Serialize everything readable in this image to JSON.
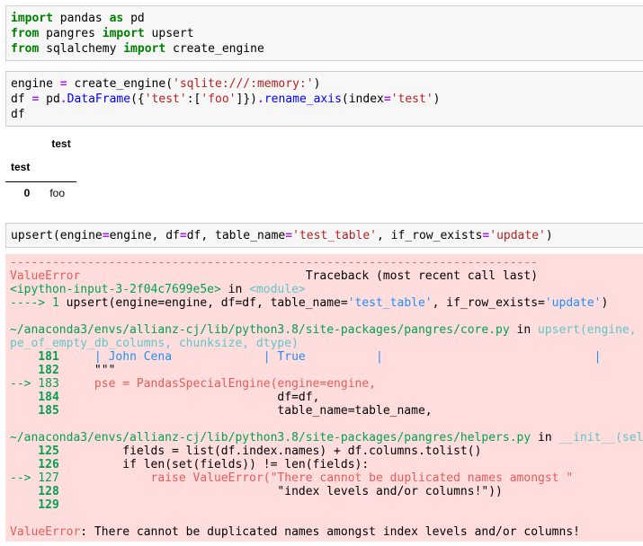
{
  "cell1": {
    "l1": [
      "import",
      " pandas ",
      "as",
      " pd"
    ],
    "l2": [
      "from",
      " pangres ",
      "import",
      " upsert"
    ],
    "l3": [
      "from",
      " sqlalchemy ",
      "import",
      " create_engine"
    ]
  },
  "cell2": {
    "l1a": "engine ",
    "l1b": "=",
    "l1c": " create_engine(",
    "l1d": "'sqlite:///:memory:'",
    "l1e": ")",
    "l2a": "df ",
    "l2b": "=",
    "l2c": " pd",
    "l2d": ".",
    "l2e": "DataFrame",
    "l2f": "({",
    "l2g": "'test'",
    "l2h": ":[",
    "l2i": "'foo'",
    "l2j": "]})",
    "l2k": ".",
    "l2l": "rename_axis",
    "l2m": "(index",
    "l2n": "=",
    "l2o": "'test'",
    "l2p": ")",
    "l3": "df"
  },
  "dataframe": {
    "col_header": "test",
    "index_name": "test",
    "rows": [
      {
        "index": "0",
        "value": "foo"
      }
    ]
  },
  "cell3": {
    "a": "upsert(engine",
    "b": "=",
    "c": "engine, df",
    "d": "=",
    "e": "df, table_name",
    "f": "=",
    "g": "'test_table'",
    "h": ", if_row_exists",
    "i": "=",
    "j": "'update'",
    "k": ")"
  },
  "error": {
    "dashes": "---------------------------------------------------------------------------",
    "etype": "ValueError",
    "tb_head": "                                Traceback (most recent call last)",
    "input_ref": "<ipython-input-3-2f04c7699e5e>",
    "in_word": " in ",
    "module": "<module>",
    "arrow1": "----> 1 ",
    "call1a": "upsert(engine=engine, df=df, table_name=",
    "call1b": "'test_table'",
    "call1c": ", if_row_exists=",
    "call1d": "'update'",
    "call1e": ")",
    "path1": "~/anaconda3/envs/allianz-cj/lib/python3.8/site-packages/pangres/core.py",
    "fn1": "upsert(engine,",
    "fn1b": "pe_of_empty_db_columns, chunksize, dtype)",
    "c181n": "    181 ",
    "c181": "    | John Cena             | True          |                              |",
    "c182n": "    182 ",
    "c182": "    \"\"\"",
    "c183n": "--> 183 ",
    "c183": "    pse = PandasSpecialEngine(engine=engine,",
    "c184n": "    184 ",
    "c184": "                              df=df,",
    "c185n": "    185 ",
    "c185": "                              table_name=table_name,",
    "path2": "~/anaconda3/envs/allianz-cj/lib/python3.8/site-packages/pangres/helpers.py",
    "fn2": "__init__(sel",
    "c125n": "    125 ",
    "c125": "        fields = list(df.index.names) + df.columns.tolist()",
    "c126n": "    126 ",
    "c126": "        if len(set(fields)) != len(fields):",
    "c127n": "--> 127 ",
    "c127a": "            raise ValueError(",
    "c127b": "\"There cannot be duplicated names amongst \"",
    "c128n": "    128 ",
    "c128": "                              \"index levels and/or columns!\"))",
    "c129n": "    129 ",
    "final_type": "ValueError",
    "final_msg": ": There cannot be duplicated names amongst index levels and/or columns!"
  }
}
